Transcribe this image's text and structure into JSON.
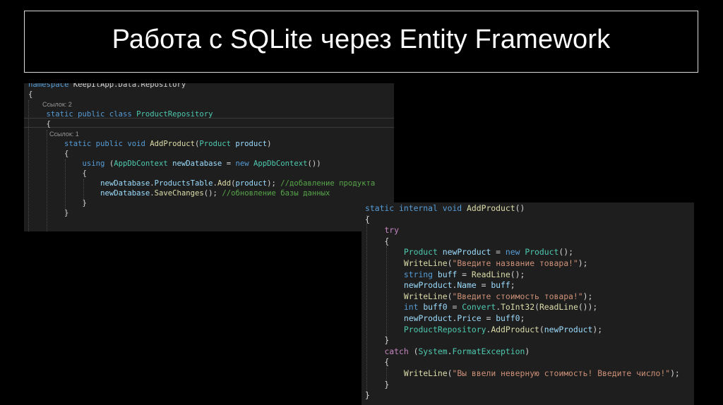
{
  "slide": {
    "title": "Работа с SQLite через Entity Framework"
  },
  "colors": {
    "keyword": "#569cd6",
    "control_keyword": "#c586c0",
    "type": "#4ec9b0",
    "variable": "#9cdcfe",
    "method": "#dcdcaa",
    "string": "#ce9178",
    "comment": "#57a64a",
    "punctuation": "#d4d4d4",
    "codelens": "#999999",
    "editor_bg": "#1e1e1e"
  },
  "panel1": {
    "lines": [
      [
        {
          "t": "namespace ",
          "c": "kw"
        },
        {
          "t": "KeepItApp.Data.Repository",
          "c": "pun"
        }
      ],
      [
        {
          "t": "{",
          "c": "pun"
        }
      ],
      [
        {
          "t": "        Ссылок: 2",
          "c": "hint"
        }
      ],
      [
        {
          "t": "    ",
          "c": "pun"
        },
        {
          "t": "static public class ",
          "c": "kw"
        },
        {
          "t": "ProductRepository",
          "c": "type"
        }
      ],
      [
        {
          "t": "    {",
          "c": "pun"
        }
      ],
      [
        {
          "t": "            Ссылок: 1",
          "c": "hint"
        }
      ],
      [
        {
          "t": "        ",
          "c": "pun"
        },
        {
          "t": "static public void ",
          "c": "kw"
        },
        {
          "t": "AddProduct",
          "c": "fn"
        },
        {
          "t": "(",
          "c": "pun"
        },
        {
          "t": "Product ",
          "c": "type"
        },
        {
          "t": "product",
          "c": "var"
        },
        {
          "t": ")",
          "c": "pun"
        }
      ],
      [
        {
          "t": "        {",
          "c": "pun"
        }
      ],
      [
        {
          "t": "            ",
          "c": "pun"
        },
        {
          "t": "using ",
          "c": "kw"
        },
        {
          "t": "(",
          "c": "pun"
        },
        {
          "t": "AppDbContext ",
          "c": "type"
        },
        {
          "t": "newDatabase",
          "c": "var"
        },
        {
          "t": " = ",
          "c": "pun"
        },
        {
          "t": "new ",
          "c": "kw"
        },
        {
          "t": "AppDbContext",
          "c": "type"
        },
        {
          "t": "())",
          "c": "pun"
        }
      ],
      [
        {
          "t": "            {",
          "c": "pun"
        }
      ],
      [
        {
          "t": "                ",
          "c": "pun"
        },
        {
          "t": "newDatabase",
          "c": "var"
        },
        {
          "t": ".",
          "c": "pun"
        },
        {
          "t": "ProductsTable",
          "c": "var"
        },
        {
          "t": ".",
          "c": "pun"
        },
        {
          "t": "Add",
          "c": "fn"
        },
        {
          "t": "(",
          "c": "pun"
        },
        {
          "t": "product",
          "c": "var"
        },
        {
          "t": "); ",
          "c": "pun"
        },
        {
          "t": "//добавление продукта",
          "c": "cm"
        }
      ],
      [
        {
          "t": "                ",
          "c": "pun"
        },
        {
          "t": "newDatabase",
          "c": "var"
        },
        {
          "t": ".",
          "c": "pun"
        },
        {
          "t": "SaveChanges",
          "c": "fn"
        },
        {
          "t": "(); ",
          "c": "pun"
        },
        {
          "t": "//обновление базы данных",
          "c": "cm"
        }
      ],
      [
        {
          "t": "            }",
          "c": "pun"
        }
      ],
      [
        {
          "t": "        }",
          "c": "pun"
        }
      ],
      [
        {
          "t": "",
          "c": "pun"
        }
      ]
    ]
  },
  "panel2": {
    "lines": [
      [
        {
          "t": "static internal void ",
          "c": "kw"
        },
        {
          "t": "AddProduct",
          "c": "fn"
        },
        {
          "t": "()",
          "c": "pun"
        }
      ],
      [
        {
          "t": "{",
          "c": "pun"
        }
      ],
      [
        {
          "t": "    ",
          "c": "pun"
        },
        {
          "t": "try",
          "c": "kw2"
        }
      ],
      [
        {
          "t": "    {",
          "c": "pun"
        }
      ],
      [
        {
          "t": "        ",
          "c": "pun"
        },
        {
          "t": "Product ",
          "c": "type"
        },
        {
          "t": "newProduct",
          "c": "var"
        },
        {
          "t": " = ",
          "c": "pun"
        },
        {
          "t": "new ",
          "c": "kw"
        },
        {
          "t": "Product",
          "c": "type"
        },
        {
          "t": "();",
          "c": "pun"
        }
      ],
      [
        {
          "t": "        ",
          "c": "pun"
        },
        {
          "t": "WriteLine",
          "c": "fn"
        },
        {
          "t": "(",
          "c": "pun"
        },
        {
          "t": "\"Введите название товара!\"",
          "c": "str"
        },
        {
          "t": ");",
          "c": "pun"
        }
      ],
      [
        {
          "t": "        ",
          "c": "pun"
        },
        {
          "t": "string ",
          "c": "kw"
        },
        {
          "t": "buff",
          "c": "var"
        },
        {
          "t": " = ",
          "c": "pun"
        },
        {
          "t": "ReadLine",
          "c": "fn"
        },
        {
          "t": "();",
          "c": "pun"
        }
      ],
      [
        {
          "t": "        ",
          "c": "pun"
        },
        {
          "t": "newProduct",
          "c": "var"
        },
        {
          "t": ".",
          "c": "pun"
        },
        {
          "t": "Name",
          "c": "var"
        },
        {
          "t": " = ",
          "c": "pun"
        },
        {
          "t": "buff",
          "c": "var"
        },
        {
          "t": ";",
          "c": "pun"
        }
      ],
      [
        {
          "t": "        ",
          "c": "pun"
        },
        {
          "t": "WriteLine",
          "c": "fn"
        },
        {
          "t": "(",
          "c": "pun"
        },
        {
          "t": "\"Введите стоимость товара!\"",
          "c": "str"
        },
        {
          "t": ");",
          "c": "pun"
        }
      ],
      [
        {
          "t": "        ",
          "c": "pun"
        },
        {
          "t": "int ",
          "c": "kw"
        },
        {
          "t": "buff0",
          "c": "var"
        },
        {
          "t": " = ",
          "c": "pun"
        },
        {
          "t": "Convert",
          "c": "type"
        },
        {
          "t": ".",
          "c": "pun"
        },
        {
          "t": "ToInt32",
          "c": "fn"
        },
        {
          "t": "(",
          "c": "pun"
        },
        {
          "t": "ReadLine",
          "c": "fn"
        },
        {
          "t": "());",
          "c": "pun"
        }
      ],
      [
        {
          "t": "        ",
          "c": "pun"
        },
        {
          "t": "newProduct",
          "c": "var"
        },
        {
          "t": ".",
          "c": "pun"
        },
        {
          "t": "Price",
          "c": "var"
        },
        {
          "t": " = ",
          "c": "pun"
        },
        {
          "t": "buff0",
          "c": "var"
        },
        {
          "t": ";",
          "c": "pun"
        }
      ],
      [
        {
          "t": "        ",
          "c": "pun"
        },
        {
          "t": "ProductRepository",
          "c": "type"
        },
        {
          "t": ".",
          "c": "pun"
        },
        {
          "t": "AddProduct",
          "c": "fn"
        },
        {
          "t": "(",
          "c": "pun"
        },
        {
          "t": "newProduct",
          "c": "var"
        },
        {
          "t": ");",
          "c": "pun"
        }
      ],
      [
        {
          "t": "    }",
          "c": "pun"
        }
      ],
      [
        {
          "t": "    ",
          "c": "pun"
        },
        {
          "t": "catch ",
          "c": "kw2"
        },
        {
          "t": "(",
          "c": "pun"
        },
        {
          "t": "System",
          "c": "type"
        },
        {
          "t": ".",
          "c": "pun"
        },
        {
          "t": "FormatException",
          "c": "type"
        },
        {
          "t": ")",
          "c": "pun"
        }
      ],
      [
        {
          "t": "    {",
          "c": "pun"
        }
      ],
      [
        {
          "t": "        ",
          "c": "pun"
        },
        {
          "t": "WriteLine",
          "c": "fn"
        },
        {
          "t": "(",
          "c": "pun"
        },
        {
          "t": "\"Вы ввели неверную стоимость! Введите число!\"",
          "c": "str"
        },
        {
          "t": ");",
          "c": "pun"
        }
      ],
      [
        {
          "t": "    }",
          "c": "pun"
        }
      ],
      [
        {
          "t": "}",
          "c": "pun"
        }
      ]
    ]
  }
}
